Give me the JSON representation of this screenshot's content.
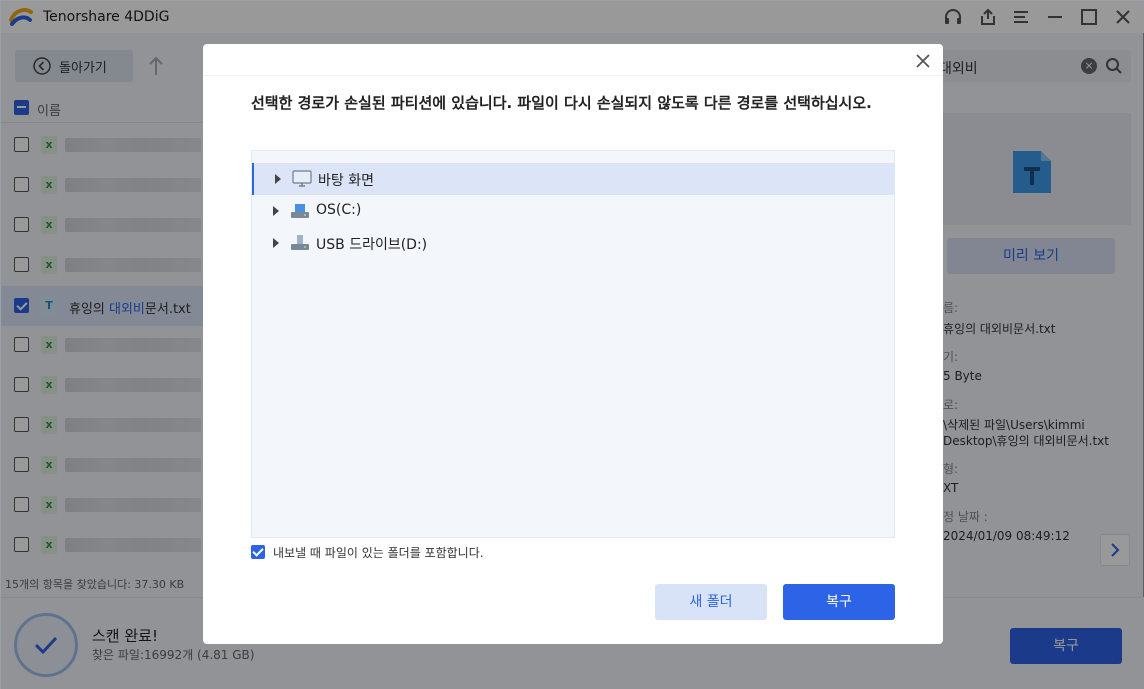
{
  "app": {
    "title": "Tenorshare 4DDiG"
  },
  "toolbar": {
    "back_label": "돌아가기",
    "search_value": "대외비"
  },
  "file_list": {
    "header_label": "이름",
    "rows": [
      {
        "type": "xls",
        "checked": false,
        "name": ""
      },
      {
        "type": "xls",
        "checked": false,
        "name": ""
      },
      {
        "type": "xls",
        "checked": false,
        "name": ""
      },
      {
        "type": "xls",
        "checked": false,
        "name": ""
      },
      {
        "type": "txt",
        "checked": true,
        "name_prefix": "휴잉의 ",
        "name_highlight": "대외비",
        "name_suffix": "문서.txt"
      },
      {
        "type": "xls",
        "checked": false,
        "name": ""
      },
      {
        "type": "xls",
        "checked": false,
        "name": ""
      },
      {
        "type": "xls",
        "checked": false,
        "name": ""
      },
      {
        "type": "xls",
        "checked": false,
        "name": ""
      },
      {
        "type": "xls",
        "checked": false,
        "name": ""
      },
      {
        "type": "xls",
        "checked": false,
        "name": ""
      }
    ],
    "found_text": "15개의 항목을 찾았습니다: 37.30 KB"
  },
  "right_panel": {
    "preview_button": "미리 보기",
    "name_label": "름:",
    "name_value": "휴잉의 대외비문서.txt",
    "size_label": "기:",
    "size_value": "5 Byte",
    "path_label": "로:",
    "path_value_1": "\\삭제된 파일\\Users\\kimmi",
    "path_value_2": "Desktop\\휴잉의 대외비문서.txt",
    "type_label": "형:",
    "type_value": "XT",
    "date_label": "정 날짜 :",
    "date_value": "2024/01/09 08:49:12"
  },
  "bottom": {
    "scan_title": "스캔 완료!",
    "scan_sub": "찾은 파일:16992개 (4.81 GB)",
    "recover_button": "복구"
  },
  "dialog": {
    "message": "선택한 경로가 손실된 파티션에 있습니다. 파일이 다시 손실되지 않도록 다른 경로를 선택하십시오.",
    "tree": [
      {
        "label": "바탕 화면",
        "icon": "monitor-icon",
        "selected": true
      },
      {
        "label": "OS(C:)",
        "icon": "drive-icon",
        "selected": false
      },
      {
        "label": "USB 드라이브(D:)",
        "icon": "usb-drive-icon",
        "selected": false
      }
    ],
    "include_folder_label": "내보낼 때 파일이 있는 폴더를 포함합니다.",
    "include_folder_checked": true,
    "new_folder_button": "새 폴더",
    "recover_button": "복구"
  },
  "colors": {
    "accent": "#2d63e6",
    "overlay": "rgba(0,0,0,0.40)"
  }
}
